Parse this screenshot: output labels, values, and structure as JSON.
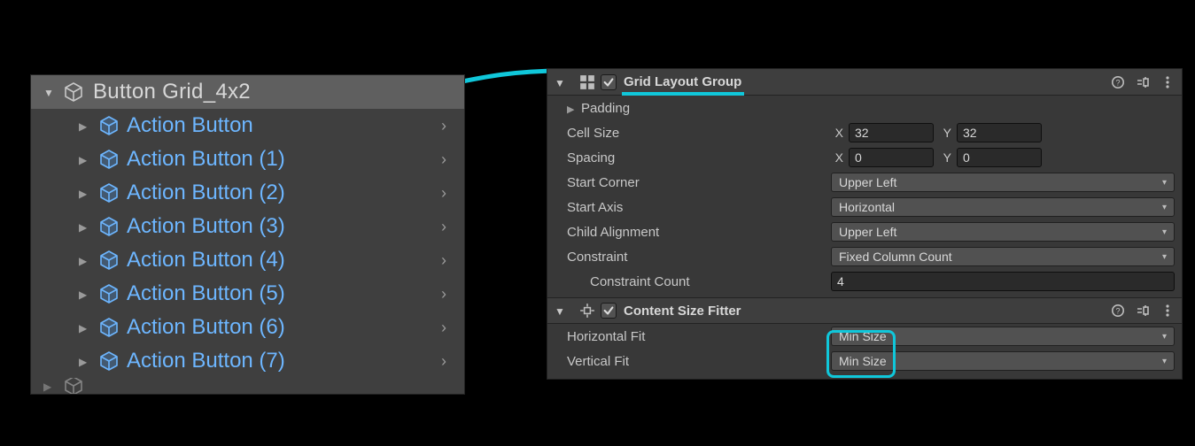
{
  "hierarchy": {
    "parent_label": "Button Grid_4x2",
    "children": [
      "Action Button",
      "Action Button (1)",
      "Action Button (2)",
      "Action Button (3)",
      "Action Button (4)",
      "Action Button (5)",
      "Action Button (6)",
      "Action Button (7)"
    ]
  },
  "inspector": {
    "grid_layout": {
      "title": "Grid Layout Group",
      "enabled": true,
      "padding_label": "Padding",
      "cell_size_label": "Cell Size",
      "cell_size_x": "32",
      "cell_size_y": "32",
      "spacing_label": "Spacing",
      "spacing_x": "0",
      "spacing_y": "0",
      "start_corner_label": "Start Corner",
      "start_corner_value": "Upper Left",
      "start_axis_label": "Start Axis",
      "start_axis_value": "Horizontal",
      "child_align_label": "Child Alignment",
      "child_align_value": "Upper Left",
      "constraint_label": "Constraint",
      "constraint_value": "Fixed Column Count",
      "constraint_count_label": "Constraint Count",
      "constraint_count_value": "4",
      "axis_x": "X",
      "axis_y": "Y"
    },
    "content_fitter": {
      "title": "Content Size Fitter",
      "enabled": true,
      "hfit_label": "Horizontal Fit",
      "hfit_value": "Min Size",
      "vfit_label": "Vertical Fit",
      "vfit_value": "Min Size"
    }
  }
}
